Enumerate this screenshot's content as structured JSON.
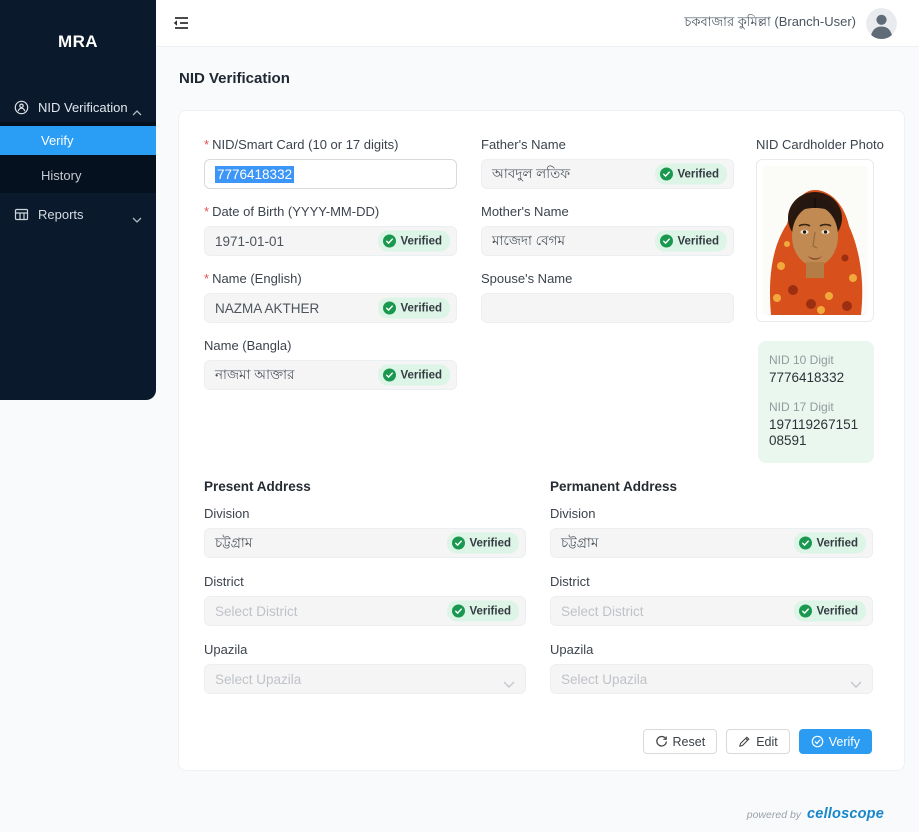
{
  "sidebar": {
    "logo": "MRA",
    "nid_verification": "NID Verification",
    "verify": "Verify",
    "history": "History",
    "reports": "Reports"
  },
  "header": {
    "user": "চকবাজার কুমিল্লা (Branch-User)"
  },
  "page": {
    "title": "NID Verification",
    "required_mark": "*"
  },
  "badge": {
    "verified": "Verified"
  },
  "form": {
    "nid": {
      "label": "NID/Smart Card (10 or 17 digits)",
      "value": "7776418332"
    },
    "dob": {
      "label": "Date of Birth (YYYY-MM-DD)",
      "value": "1971-01-01"
    },
    "name_en": {
      "label": "Name (English)",
      "value": "NAZMA AKTHER"
    },
    "name_bn": {
      "label": "Name (Bangla)",
      "value": "নাজমা আক্তার"
    },
    "father": {
      "label": "Father's Name",
      "value": "আবদুল লতিফ"
    },
    "mother": {
      "label": "Mother's Name",
      "value": "মাজেদা বেগম"
    },
    "spouse": {
      "label": "Spouse's Name",
      "value": ""
    },
    "photo_label": "NID Cardholder Photo",
    "nid10": {
      "label": "NID 10 Digit",
      "value": "7776418332"
    },
    "nid17": {
      "label": "NID 17 Digit",
      "value": "19711926715108591"
    }
  },
  "present_address": {
    "title": "Present Address",
    "division": {
      "label": "Division",
      "value": "চট্টগ্রাম"
    },
    "district": {
      "label": "District",
      "placeholder": "Select District"
    },
    "upazila": {
      "label": "Upazila",
      "placeholder": "Select Upazila"
    }
  },
  "permanent_address": {
    "title": "Permanent Address",
    "division": {
      "label": "Division",
      "value": "চট্টগ্রাম"
    },
    "district": {
      "label": "District",
      "placeholder": "Select District"
    },
    "upazila": {
      "label": "Upazila",
      "placeholder": "Select Upazila"
    }
  },
  "actions": {
    "reset": "Reset",
    "edit": "Edit",
    "verify": "Verify"
  },
  "footer": {
    "powered_by": "powered by",
    "brand": "celloscope"
  },
  "colors": {
    "accent": "#2b9cf2",
    "sidebar_bg": "#0a1a2c",
    "active_item": "#2a9df4",
    "verified_bg": "#dcf5e6",
    "verified_icon": "#1b9850",
    "selection": "#3c96f7",
    "brand_blue": "#1687c9",
    "nid_box_bg": "#e9f7ef"
  }
}
